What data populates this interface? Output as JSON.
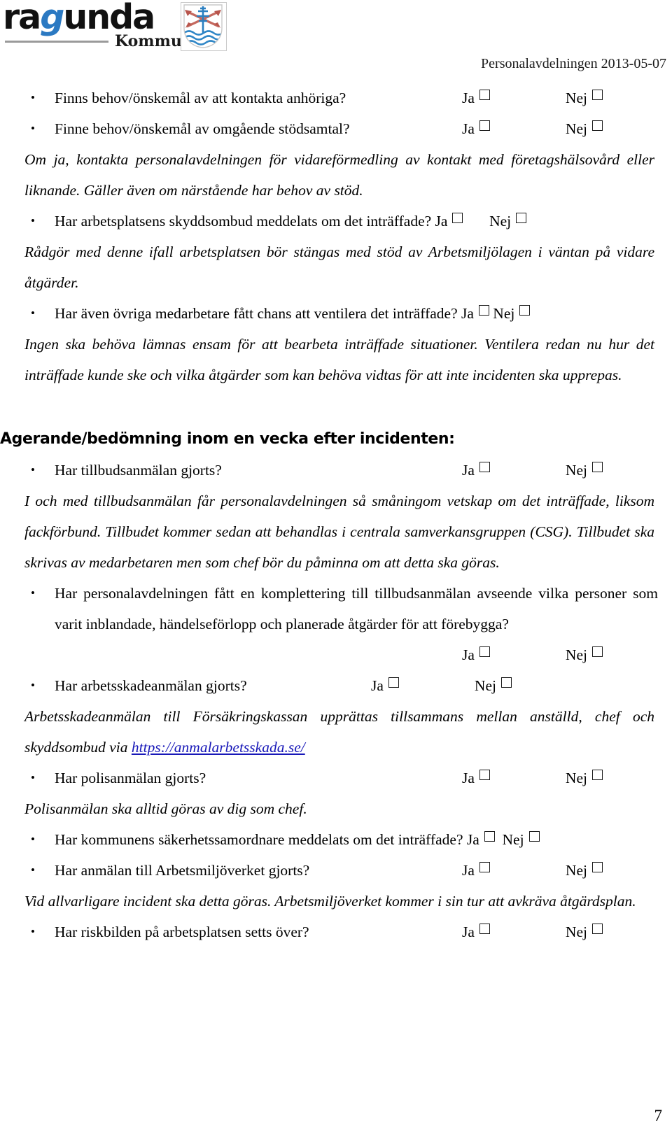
{
  "header": {
    "logo": {
      "word_before": "ra",
      "word_g": "g",
      "word_after": "unda",
      "subtitle": "Kommun",
      "crest_name": "ragunda-coat-of-arms"
    },
    "department_date": "Personalavdelningen 2013-05-07"
  },
  "answers": {
    "ja": "Ja",
    "nej": "Nej"
  },
  "items": [
    {
      "id": "kontakta-anhoriga",
      "question": "Finns behov/önskemål av att kontakta anhöriga?"
    },
    {
      "id": "omgaende-stodsamtal",
      "question": "Finne behov/önskemål av omgående stödsamtal?"
    },
    {
      "id": "skyddsombud-meddelats",
      "question": "Har arbetsplatsens skyddsombud meddelats om det inträffade?"
    },
    {
      "id": "ovriga-medarbetare-ventilera",
      "question": "Har även övriga medarbetare fått chans att ventilera det inträffade?"
    },
    {
      "id": "tillbudsanmalan-gjorts",
      "question": "Har tillbudsanmälan gjorts?"
    },
    {
      "id": "komplettering-tillbudsanmalan",
      "question": "Har personalavdelningen fått en komplettering till tillbudsanmälan avseende vilka personer som varit inblandade, händelseförlopp och planerade åtgärder för att förebygga?"
    },
    {
      "id": "arbetsskadeanmalan-gjorts",
      "question": "Har arbetsskadeanmälan gjorts?"
    },
    {
      "id": "polisanmalan-gjorts",
      "question": "Har polisanmälan gjorts?"
    },
    {
      "id": "sakerhetssamordnare-meddelats",
      "question": "Har kommunens säkerhetssamordnare meddelats om det inträffade?"
    },
    {
      "id": "anmalan-arbetsmiljoverket",
      "question": "Har anmälan till Arbetsmiljöverket gjorts?"
    },
    {
      "id": "riskbilden-setts-over",
      "question": "Har riskbilden på arbetsplatsen setts över?"
    }
  ],
  "notes": {
    "om_ja_kontakta": "Om ja, kontakta personalavdelningen för vidareförmedling av kontakt med företagshälsovård eller liknande. Gäller även om närstående har behov av stöd.",
    "radgor_med_denne": "Rådgör med denne ifall arbetsplatsen bör stängas med stöd av Arbetsmiljölagen i väntan på vidare åtgärder.",
    "ingen_ska_behova": "Ingen ska behöva lämnas ensam för att bearbeta inträffade situationer. Ventilera redan nu hur det inträffade kunde ske och vilka åtgärder som kan behöva vidtas för att inte incidenten ska upprepas.",
    "i_och_med_tillbudsanmalan": "I och med tillbudsanmälan får personalavdelningen så småningom vetskap om det inträffade, liksom fackförbund. Tillbudet kommer sedan att behandlas i centrala samverkansgruppen (CSG). Tillbudet ska skrivas av medarbetaren men som chef bör du påminna om att detta ska göras.",
    "arbetsskadeanmalan_prefix": "Arbetsskadeanmälan till Försäkringskassan upprättas tillsammans mellan anställd, chef och skyddsombud via ",
    "arbetsskadeanmalan_link": "https://anmalarbetsskada.se/",
    "polisanmalan_note": "Polisanmälan ska alltid göras av dig som chef.",
    "vid_allvarligare_incident": "Vid allvarligare incident ska detta göras. Arbetsmiljöverket kommer i sin tur att avkräva åtgärdsplan."
  },
  "section_heading": "Agerande/bedömning inom en vecka efter incidenten:",
  "page_number": "7"
}
